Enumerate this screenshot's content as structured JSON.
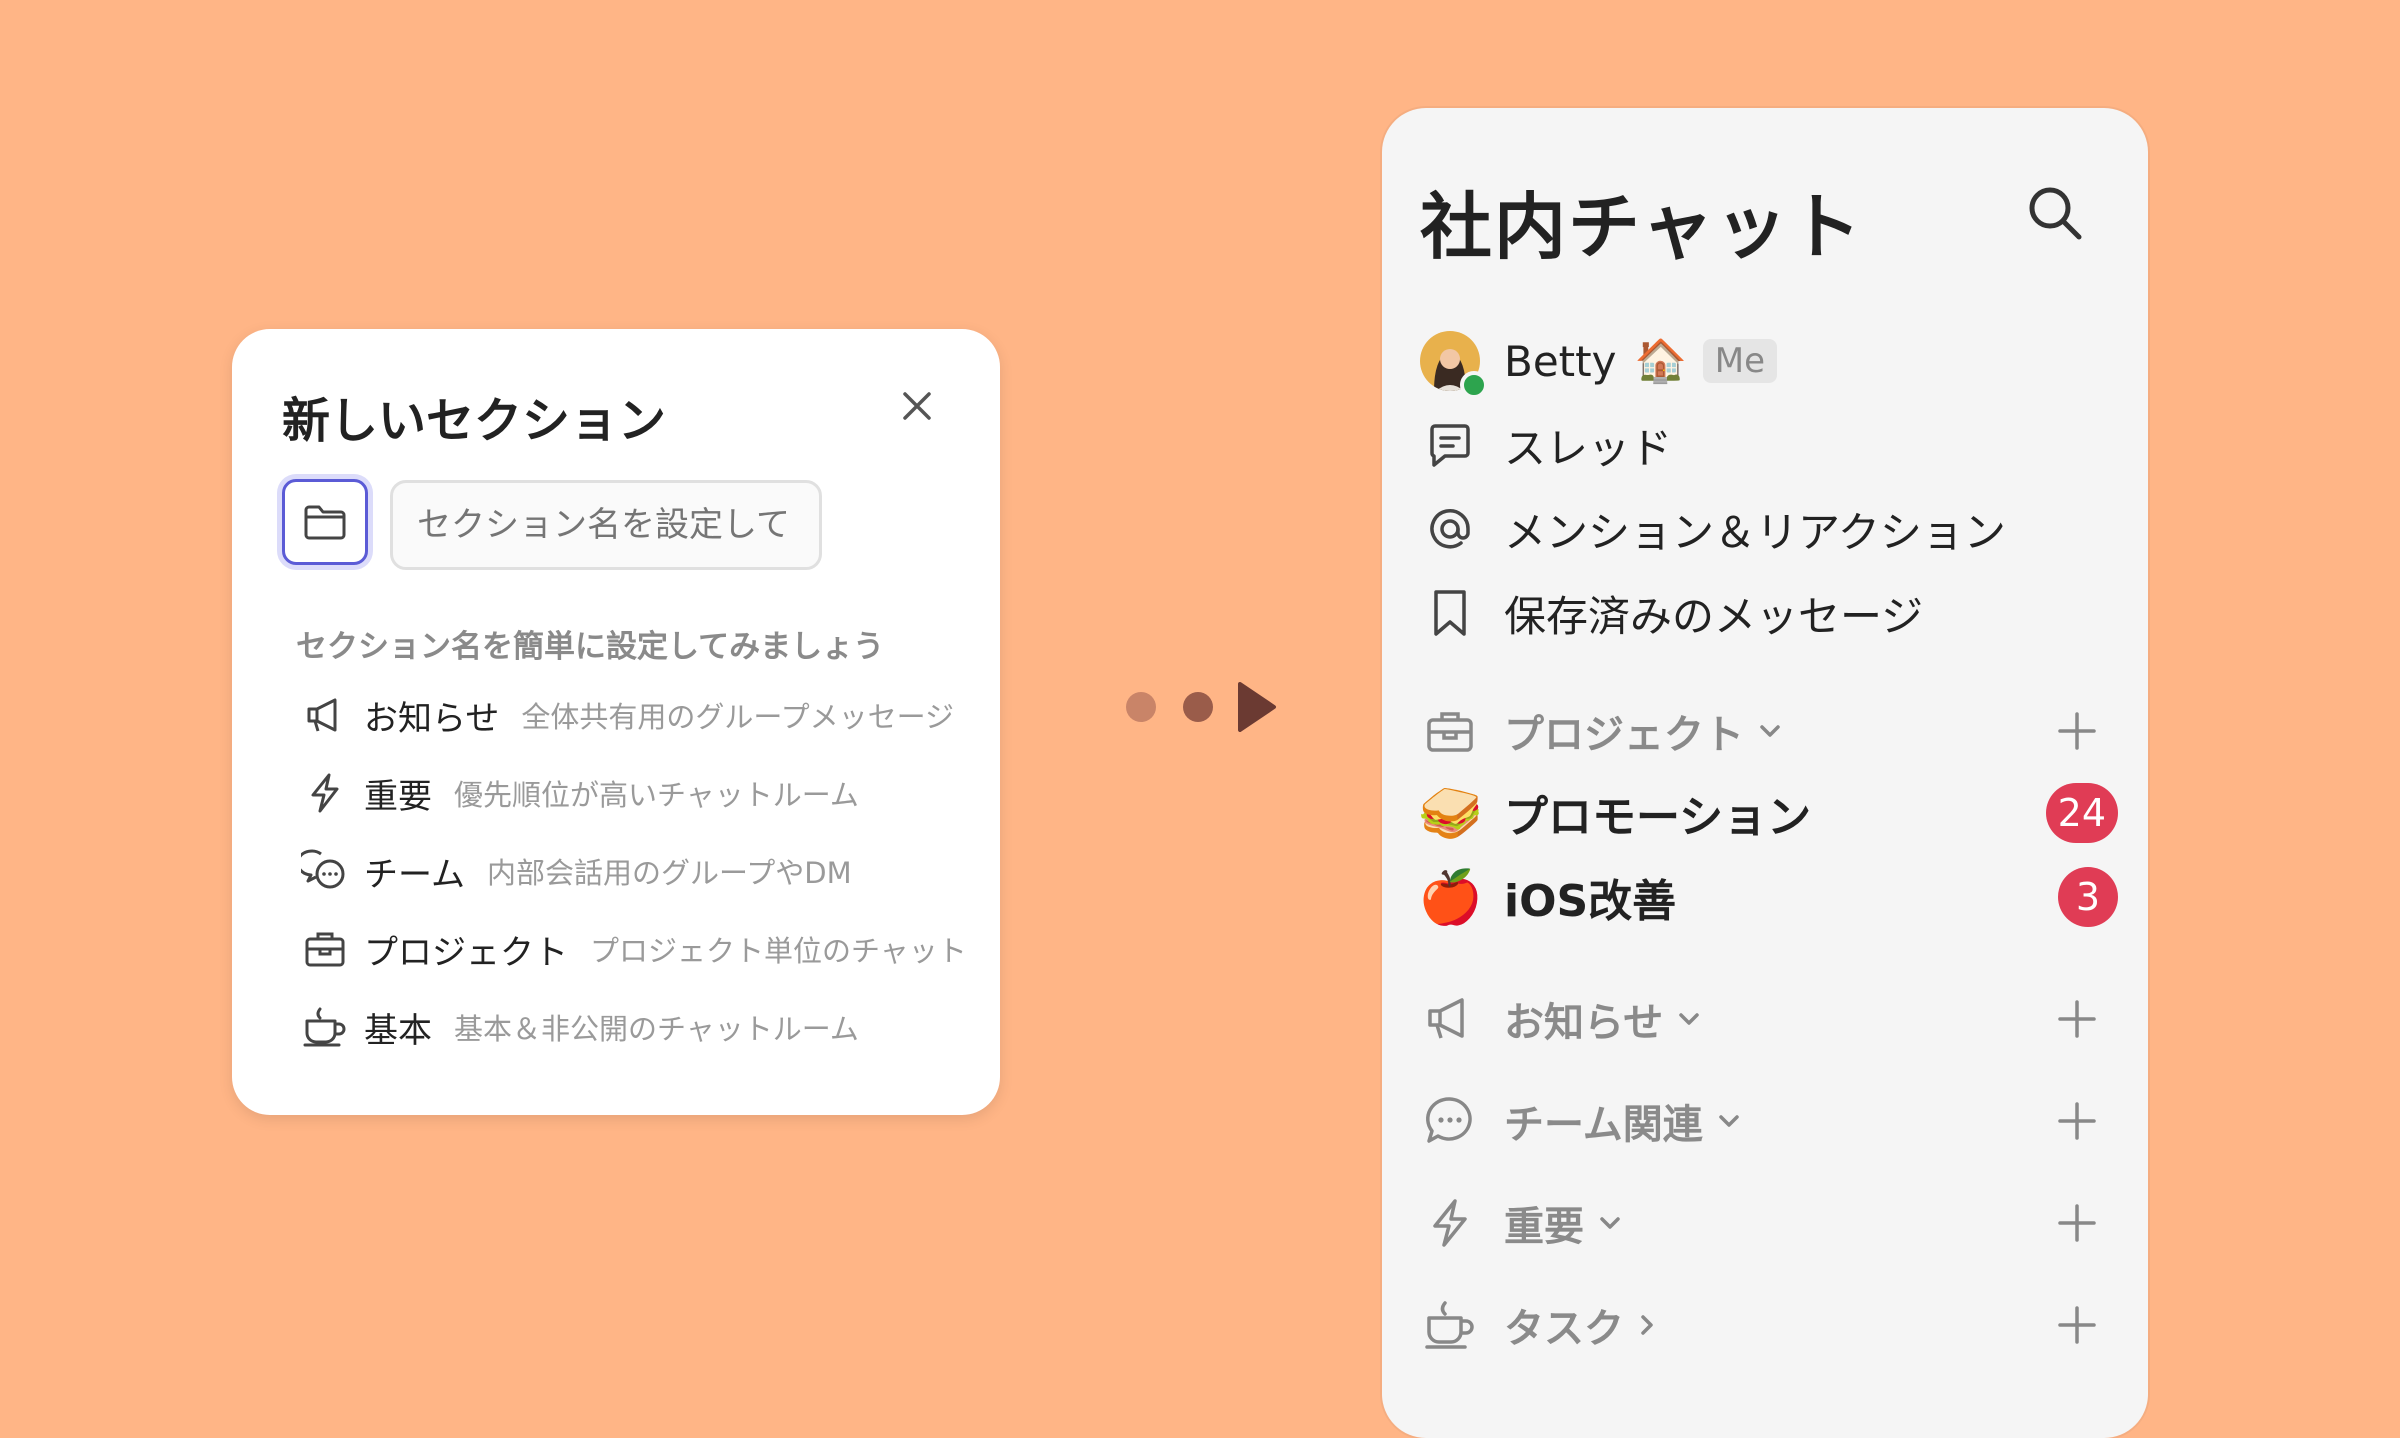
{
  "dialog": {
    "title": "新しいセクション",
    "input_placeholder": "セクション名を設定してください",
    "hint": "セクション名を簡単に設定してみましょう",
    "suggestions": [
      {
        "icon": "megaphone-icon",
        "name": "お知らせ",
        "desc": "全体共有用のグループメッセージ"
      },
      {
        "icon": "lightning-icon",
        "name": "重要",
        "desc": "優先順位が高いチャットルーム"
      },
      {
        "icon": "chat-bubbles-icon",
        "name": "チーム",
        "desc": "内部会話用のグループやDM"
      },
      {
        "icon": "briefcase-icon",
        "name": "プロジェクト",
        "desc": "プロジェクト単位のチャット"
      },
      {
        "icon": "coffee-cup-icon",
        "name": "基本",
        "desc": "基本＆非公開のチャットルーム"
      }
    ]
  },
  "panel": {
    "title": "社内チャット",
    "user": {
      "name": "Betty",
      "emoji": "🏠",
      "me_label": "Me",
      "status_color": "#2da44e"
    },
    "nav": [
      {
        "icon": "thread-icon",
        "label": "スレッド"
      },
      {
        "icon": "at-icon",
        "label": "メンション＆リアクション"
      },
      {
        "icon": "bookmark-icon",
        "label": "保存済みのメッセージ"
      }
    ],
    "project_section": {
      "label": "プロジェクト"
    },
    "channels": [
      {
        "emoji": "🥪",
        "label": "プロモーション",
        "badge": "24"
      },
      {
        "emoji": "🍎",
        "label": "iOS改善",
        "badge": "3"
      }
    ],
    "sections": [
      {
        "icon": "megaphone-icon",
        "label": "お知らせ",
        "chevron": "down"
      },
      {
        "icon": "chat-bubbles-icon",
        "label": "チーム関連",
        "chevron": "down"
      },
      {
        "icon": "lightning-icon",
        "label": "重要",
        "chevron": "down"
      },
      {
        "icon": "coffee-cup-icon",
        "label": "タスク",
        "chevron": "right"
      }
    ]
  },
  "colors": {
    "background": "#ffb586",
    "accent": "#5b5bd6",
    "badge": "#e03c55",
    "panel_bg": "#f5f5f5",
    "arrow_dots": [
      "#c98468",
      "#9a5c4a",
      "#6b3a32"
    ]
  }
}
